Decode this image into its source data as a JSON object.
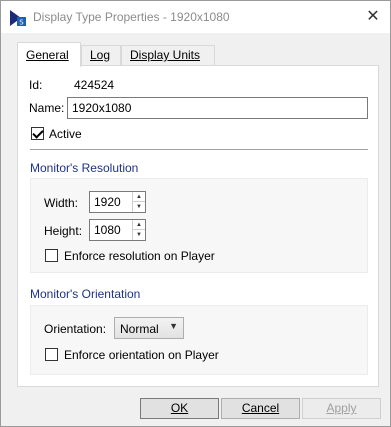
{
  "window": {
    "title": "Display Type Properties - 1920x1080",
    "close_glyph": "✕",
    "app_icon": "app-icon",
    "close_icon": "close-icon"
  },
  "tabs": [
    {
      "label": "General",
      "active": true
    },
    {
      "label": "Log",
      "active": false
    },
    {
      "label": "Display Units",
      "active": false
    }
  ],
  "general": {
    "id_label": "Id:",
    "id_value": "424524",
    "name_label": "Name:",
    "name_value": "1920x1080",
    "active_label": "Active",
    "active_checked": true
  },
  "resolution": {
    "title": "Monitor's Resolution",
    "width_label": "Width:",
    "width_value": "1920",
    "height_label": "Height:",
    "height_value": "1080",
    "enforce_label": "Enforce resolution on Player",
    "enforce_checked": false
  },
  "orientation": {
    "title": "Monitor's Orientation",
    "orientation_label": "Orientation:",
    "orientation_value": "Normal",
    "enforce_label": "Enforce orientation on Player",
    "enforce_checked": false
  },
  "buttons": {
    "ok": "OK",
    "cancel": "Cancel",
    "apply": "Apply"
  },
  "colors": {
    "group_title": "#1e3287",
    "panel_bg": "#ffffff",
    "window_bg": "#f0f0f0"
  }
}
